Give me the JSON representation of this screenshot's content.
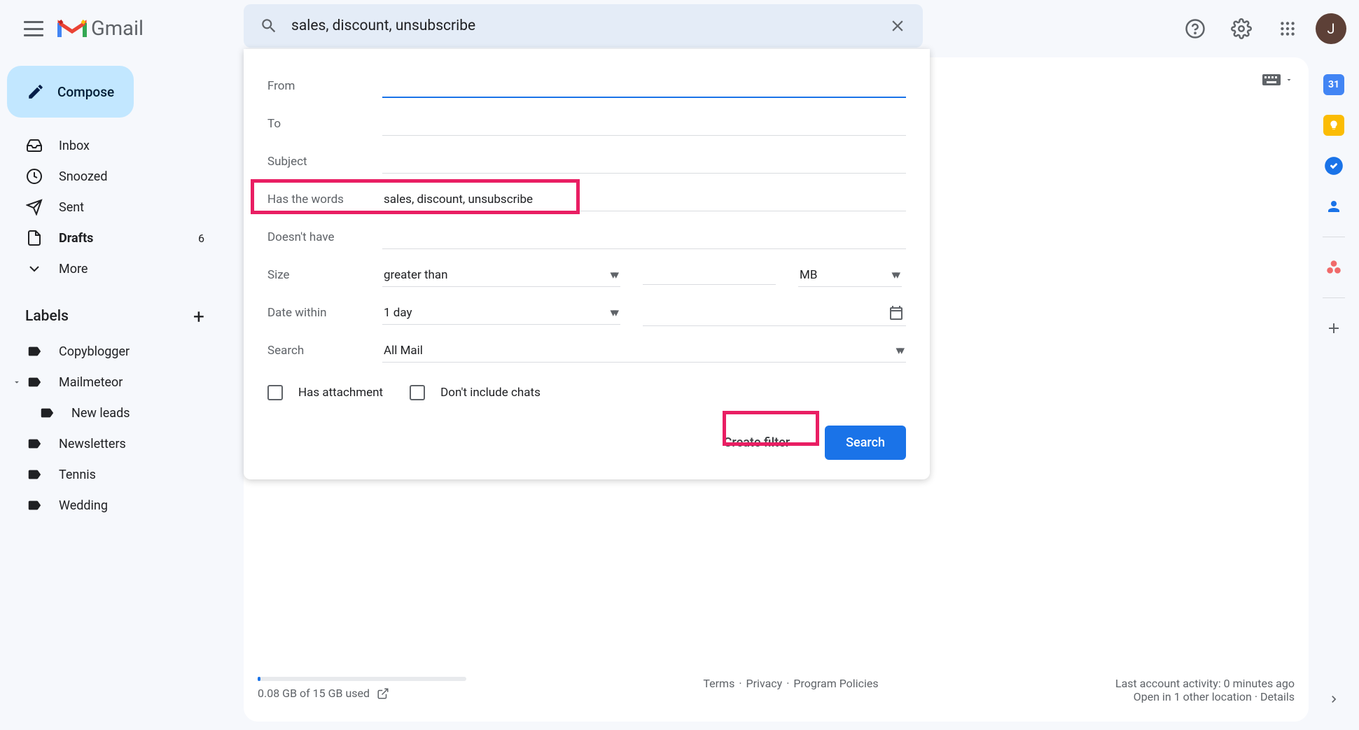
{
  "app": {
    "name": "Gmail"
  },
  "search": {
    "value": "sales, discount, unsubscribe"
  },
  "compose": {
    "label": "Compose"
  },
  "nav": {
    "inbox": "Inbox",
    "snoozed": "Snoozed",
    "sent": "Sent",
    "drafts": "Drafts",
    "drafts_count": "6",
    "more": "More"
  },
  "labels": {
    "header": "Labels",
    "items": {
      "copyblogger": "Copyblogger",
      "mailmeteor": "Mailmeteor",
      "new_leads": "New leads",
      "newsletters": "Newsletters",
      "tennis": "Tennis",
      "wedding": "Wedding"
    }
  },
  "filter": {
    "from_label": "From",
    "to_label": "To",
    "subject_label": "Subject",
    "has_words_label": "Has the words",
    "has_words_value": "sales, discount, unsubscribe",
    "doesnt_have_label": "Doesn't have",
    "size_label": "Size",
    "size_op": "greater than",
    "size_unit": "MB",
    "date_within_label": "Date within",
    "date_within_value": "1 day",
    "search_label": "Search",
    "search_value": "All Mail",
    "has_attachment": "Has attachment",
    "dont_include_chats": "Don't include chats",
    "create_filter": "Create filter",
    "search_btn": "Search"
  },
  "footer": {
    "storage": "0.08 GB of 15 GB used",
    "terms": "Terms",
    "privacy": "Privacy",
    "policies": "Program Policies",
    "activity": "Last account activity: 0 minutes ago",
    "open_in": "Open in 1 other location",
    "details": "Details"
  },
  "avatar": {
    "initial": "J"
  }
}
